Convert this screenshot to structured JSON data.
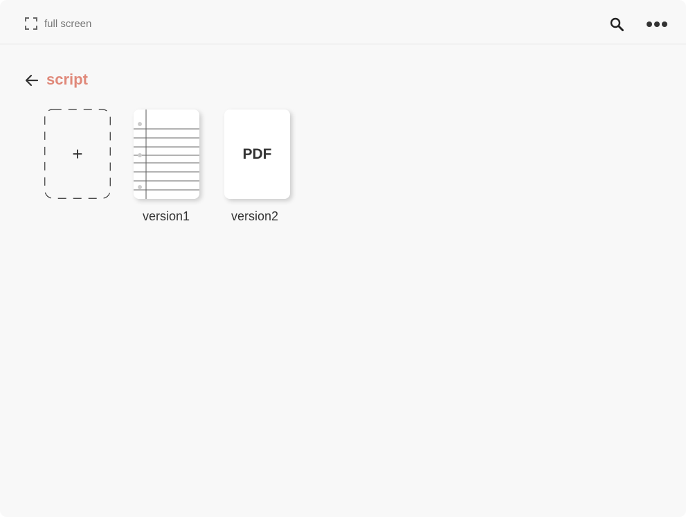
{
  "toolbar": {
    "fullscreen_label": "full screen",
    "fullscreen_icon": "expand-icon",
    "search_icon": "search-icon",
    "more_icon": "more-horizontal-icon"
  },
  "folder": {
    "title": "script",
    "back_icon": "arrow-left-icon",
    "title_color": "#e0897a"
  },
  "add_card": {
    "label": "+"
  },
  "files": [
    {
      "name": "version1",
      "type": "notebook",
      "thumbnail": "lined-paper"
    },
    {
      "name": "version2",
      "type": "pdf",
      "thumb_label": "PDF"
    }
  ]
}
